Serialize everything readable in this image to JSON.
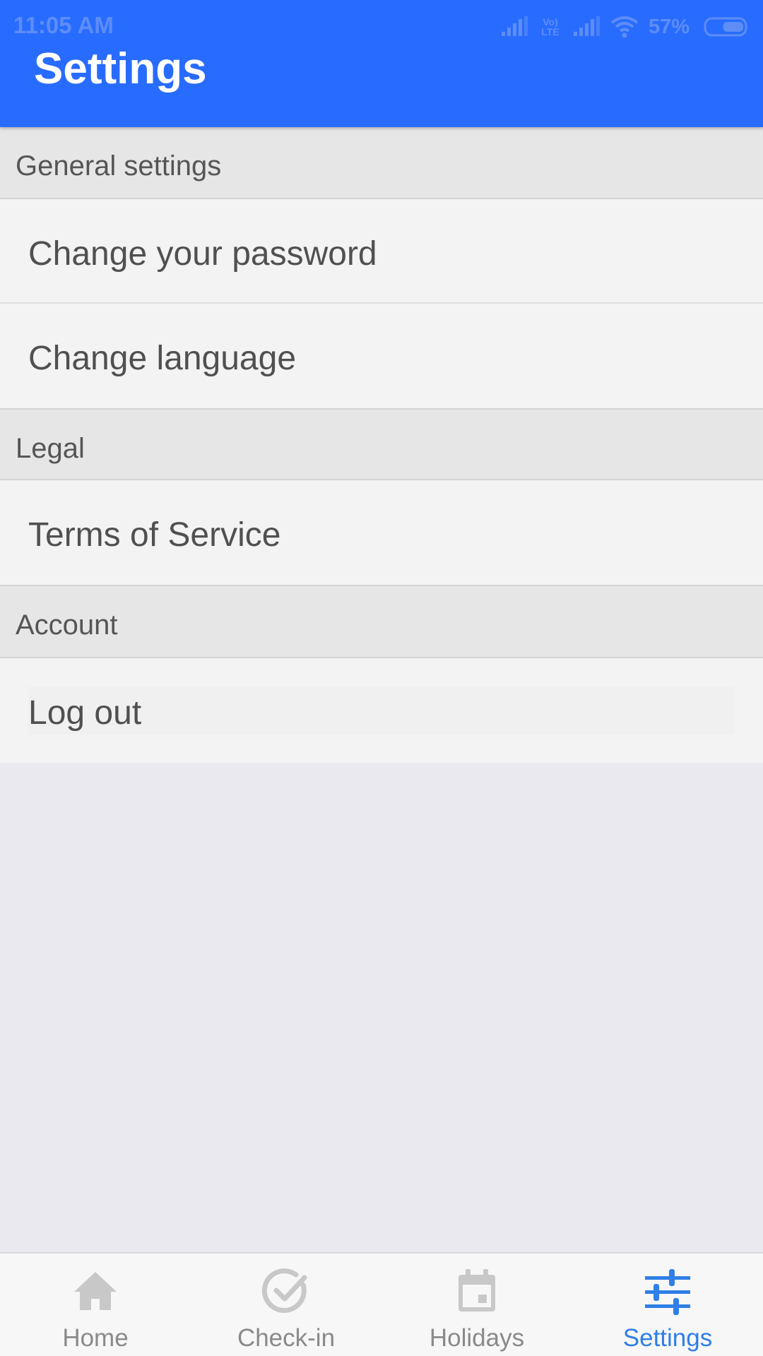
{
  "status_bar": {
    "time": "11:05 AM",
    "network_label": "Vo) LTE",
    "battery_percent": "57%",
    "battery_level": 0.57
  },
  "header": {
    "title": "Settings",
    "color": "#286cff"
  },
  "sections": [
    {
      "title": "General settings",
      "items": [
        "Change your password",
        "Change language"
      ]
    },
    {
      "title": "Legal",
      "items": [
        "Terms of Service"
      ]
    },
    {
      "title": "Account",
      "items": [
        "Log out"
      ]
    }
  ],
  "tabs": [
    {
      "label": "Home",
      "icon": "home-icon",
      "active": false
    },
    {
      "label": "Check-in",
      "icon": "check-circle-icon",
      "active": false
    },
    {
      "label": "Holidays",
      "icon": "calendar-icon",
      "active": false
    },
    {
      "label": "Settings",
      "icon": "sliders-icon",
      "active": true
    }
  ],
  "colors": {
    "active_tab": "#2f7fe6",
    "inactive_tab": "#8a8a8a",
    "background": "#e9e9ef"
  }
}
